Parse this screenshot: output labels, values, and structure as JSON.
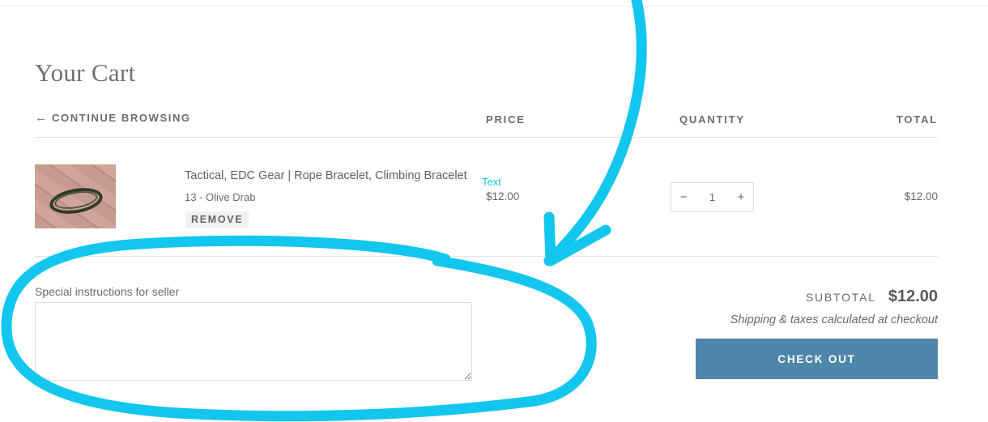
{
  "cart": {
    "title": "Your Cart",
    "continue_label": "CONTINUE BROWSING",
    "continue_arrow": "←",
    "columns": {
      "price": "PRICE",
      "quantity": "QUANTITY",
      "total": "TOTAL"
    }
  },
  "item": {
    "title": "Tactical, EDC Gear | Rope Bracelet, Climbing Bracelet",
    "variant": "13 - Olive Drab",
    "remove_label": "REMOVE",
    "price": "$12.00",
    "quantity": "1",
    "minus": "−",
    "plus": "+",
    "total": "$12.00",
    "image_icon": "rope-bracelet-photo"
  },
  "notes": {
    "label": "Special instructions for seller",
    "value": ""
  },
  "summary": {
    "subtotal_label": "SUBTOTAL",
    "subtotal_value": "$12.00",
    "shipping_note": "Shipping & taxes calculated at checkout",
    "checkout_label": "CHECK OUT"
  },
  "annotation": {
    "text": "Text",
    "color": "#12c6ee"
  },
  "colors": {
    "checkout_button": "#4e87aa",
    "annotation": "#12c6ee"
  }
}
